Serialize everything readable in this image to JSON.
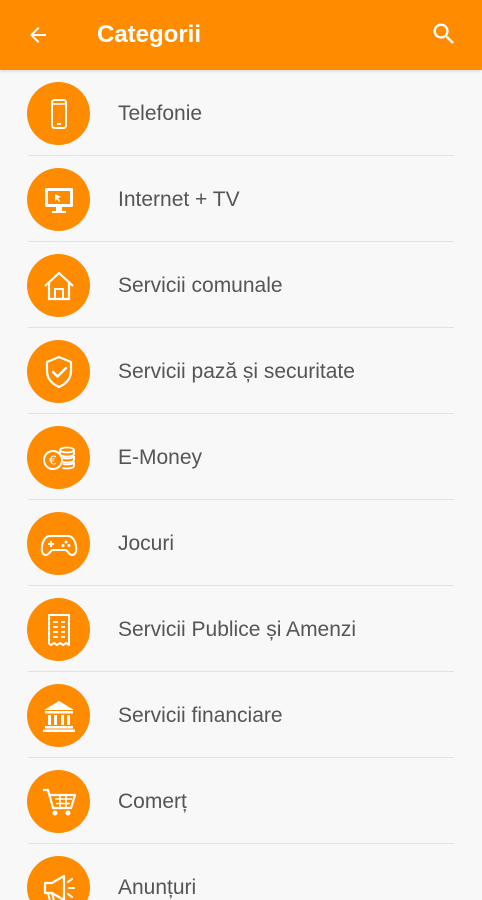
{
  "appbar": {
    "title": "Categorii",
    "back_icon": "arrow-left-icon",
    "search_icon": "search-icon",
    "color": "#ff8c00"
  },
  "categories": [
    {
      "label": "Telefonie",
      "icon": "smartphone-icon"
    },
    {
      "label": "Internet + TV",
      "icon": "monitor-icon"
    },
    {
      "label": "Servicii comunale",
      "icon": "house-icon"
    },
    {
      "label": "Servicii pază și securitate",
      "icon": "shield-check-icon"
    },
    {
      "label": "E-Money",
      "icon": "coins-icon"
    },
    {
      "label": "Jocuri",
      "icon": "gamepad-icon"
    },
    {
      "label": "Servicii Publice și Amenzi",
      "icon": "receipt-icon"
    },
    {
      "label": "Servicii financiare",
      "icon": "bank-icon"
    },
    {
      "label": "Comerț",
      "icon": "shopping-cart-icon"
    },
    {
      "label": "Anunțuri",
      "icon": "megaphone-icon"
    }
  ]
}
